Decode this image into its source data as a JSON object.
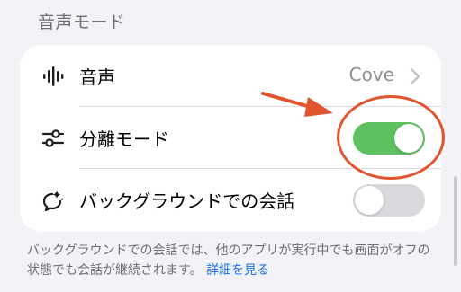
{
  "section": {
    "title": "音声モード"
  },
  "rows": [
    {
      "label": "音声",
      "value": "Cove",
      "icon": "waveform-icon"
    },
    {
      "label": "分離モード",
      "toggle": "on",
      "icon": "sliders-icon"
    },
    {
      "label": "バックグラウンドでの会話",
      "toggle": "off",
      "icon": "chat-bubble-icon"
    }
  ],
  "footer": {
    "text": "バックグラウンドでの会話では、他のアプリが実行中でも画面がオフの状態でも会話が継続されます。",
    "link": "詳細を見る"
  },
  "colors": {
    "toggle_on": "#5cc15e",
    "toggle_off": "#d9d9dd",
    "annotation": "#e2542f",
    "link": "#1a73e8"
  }
}
